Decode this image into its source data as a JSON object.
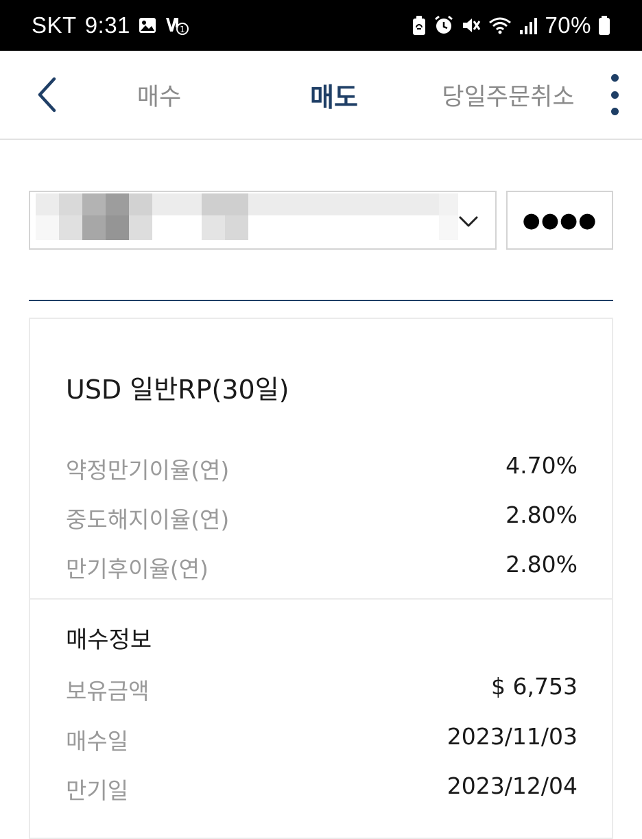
{
  "status_bar": {
    "carrier": "SKT",
    "time": "9:31",
    "battery_percent": "70%",
    "left_icons": [
      "gallery-icon",
      "volte-icon"
    ],
    "right_icons": [
      "battery-saver-icon",
      "alarm-icon",
      "mute-icon",
      "wifi-icon",
      "signal-icon",
      "battery-icon"
    ]
  },
  "header": {
    "tabs": [
      {
        "label": "매수",
        "active": false
      },
      {
        "label": "매도",
        "active": true
      },
      {
        "label": "당일주문취소",
        "active": false
      }
    ]
  },
  "account": {
    "masked_password": "●●●●"
  },
  "product": {
    "name": "USD 일반RP(30일)",
    "rates": [
      {
        "label": "약정만기이율(연)",
        "value": "4.70%"
      },
      {
        "label": "중도해지이율(연)",
        "value": "2.80%"
      },
      {
        "label": "만기후이율(연)",
        "value": "2.80%"
      }
    ],
    "purchase_info": {
      "title": "매수정보",
      "rows": [
        {
          "label": "보유금액",
          "value": "$ 6,753"
        },
        {
          "label": "매수일",
          "value": "2023/11/03"
        },
        {
          "label": "만기일",
          "value": "2023/12/04"
        }
      ]
    }
  },
  "colors": {
    "accent": "#1f3f66",
    "muted_text": "#9a9a9a",
    "border": "#d4d4d4"
  }
}
